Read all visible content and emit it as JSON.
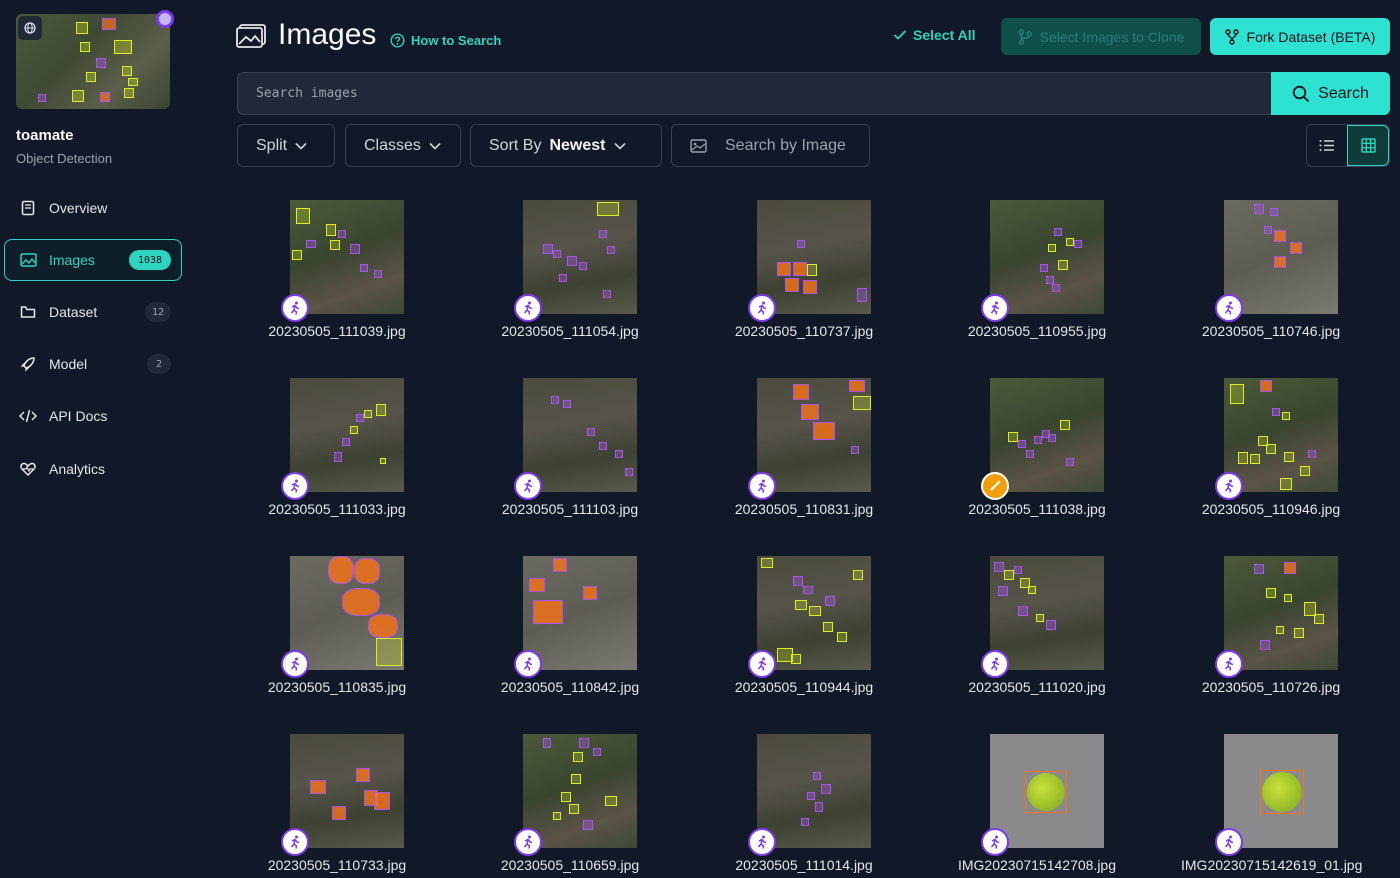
{
  "project": {
    "name": "toamate",
    "type": "Object Detection"
  },
  "sidebar": {
    "items": [
      {
        "label": "Overview",
        "icon": "book-icon",
        "badge": ""
      },
      {
        "label": "Images",
        "icon": "images-icon",
        "badge": "1038"
      },
      {
        "label": "Dataset",
        "icon": "folder-icon",
        "badge": "12"
      },
      {
        "label": "Model",
        "icon": "rocket-icon",
        "badge": "2"
      },
      {
        "label": "API Docs",
        "icon": "code-icon",
        "badge": ""
      },
      {
        "label": "Analytics",
        "icon": "heart-pulse-icon",
        "badge": ""
      }
    ]
  },
  "header": {
    "title": "Images",
    "how_to": "How to Search",
    "select_all": "Select All",
    "clone_label": "Select Images to Clone",
    "fork_label": "Fork Dataset (BETA)"
  },
  "search": {
    "placeholder": "Search images",
    "button": "Search"
  },
  "filters": {
    "split": "Split",
    "classes": "Classes",
    "sort_label": "Sort By",
    "sort_value": "Newest",
    "by_image": "Search by Image"
  },
  "colors": {
    "accent": "#2dd4bf",
    "background": "#111827",
    "annotation_purple": "#7c3aed"
  },
  "images": [
    {
      "name": "20230505_111039.jpg",
      "badge": "person-run-icon"
    },
    {
      "name": "20230505_111054.jpg",
      "badge": "person-run-icon"
    },
    {
      "name": "20230505_110737.jpg",
      "badge": "person-run-icon"
    },
    {
      "name": "20230505_110955.jpg",
      "badge": "person-run-icon"
    },
    {
      "name": "20230505_110746.jpg",
      "badge": "person-run-icon"
    },
    {
      "name": "20230505_111033.jpg",
      "badge": "person-run-icon"
    },
    {
      "name": "20230505_111103.jpg",
      "badge": "person-run-icon"
    },
    {
      "name": "20230505_110831.jpg",
      "badge": "person-run-icon"
    },
    {
      "name": "20230505_111038.jpg",
      "badge": "wand-icon"
    },
    {
      "name": "20230505_110946.jpg",
      "badge": "person-run-icon"
    },
    {
      "name": "20230505_110835.jpg",
      "badge": "person-run-icon"
    },
    {
      "name": "20230505_110842.jpg",
      "badge": "person-run-icon"
    },
    {
      "name": "20230505_110944.jpg",
      "badge": "person-run-icon"
    },
    {
      "name": "20230505_111020.jpg",
      "badge": "person-run-icon"
    },
    {
      "name": "20230505_110726.jpg",
      "badge": "person-run-icon"
    },
    {
      "name": "20230505_110733.jpg",
      "badge": "person-run-icon"
    },
    {
      "name": "20230505_110659.jpg",
      "badge": "person-run-icon"
    },
    {
      "name": "20230505_111014.jpg",
      "badge": "person-run-icon"
    },
    {
      "name": "IMG20230715142708.jpg",
      "badge": "person-run-icon"
    },
    {
      "name": "IMG20230715142619_01.jpg",
      "badge": "person-run-icon"
    }
  ]
}
